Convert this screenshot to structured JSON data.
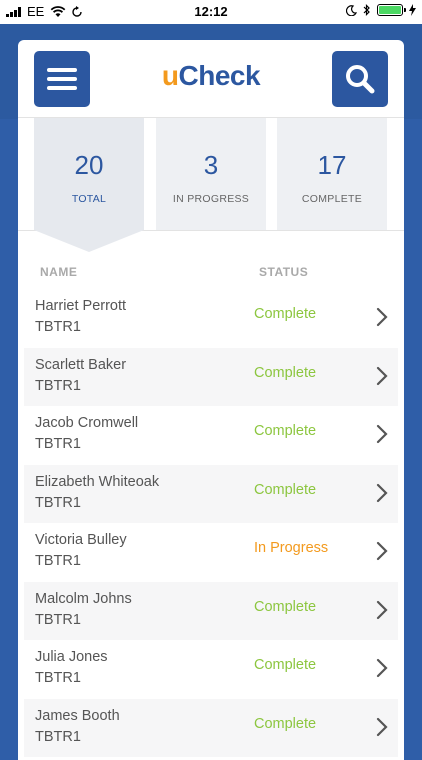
{
  "status_bar": {
    "carrier": "EE",
    "time": "12:12"
  },
  "app": {
    "logo_u": "u",
    "logo_rest": "Check"
  },
  "summary": [
    {
      "value": "20",
      "label": "TOTAL"
    },
    {
      "value": "3",
      "label": "IN PROGRESS"
    },
    {
      "value": "17",
      "label": "COMPLETE"
    }
  ],
  "columns": {
    "name": "NAME",
    "status": "STATUS"
  },
  "colors": {
    "complete": "#8cc63f",
    "in_progress": "#f39a1e",
    "brand_blue": "#2c57a0"
  },
  "rows": [
    {
      "name": "Harriet Perrott",
      "code": "TBTR1",
      "status": "Complete"
    },
    {
      "name": "Scarlett Baker",
      "code": "TBTR1",
      "status": "Complete"
    },
    {
      "name": "Jacob Cromwell",
      "code": "TBTR1",
      "status": "Complete"
    },
    {
      "name": "Elizabeth Whiteoak",
      "code": "TBTR1",
      "status": "Complete"
    },
    {
      "name": "Victoria Bulley",
      "code": "TBTR1",
      "status": "In Progress"
    },
    {
      "name": "Malcolm Johns",
      "code": "TBTR1",
      "status": "Complete"
    },
    {
      "name": "Julia Jones",
      "code": "TBTR1",
      "status": "Complete"
    },
    {
      "name": "James Booth",
      "code": "TBTR1",
      "status": "Complete"
    }
  ]
}
